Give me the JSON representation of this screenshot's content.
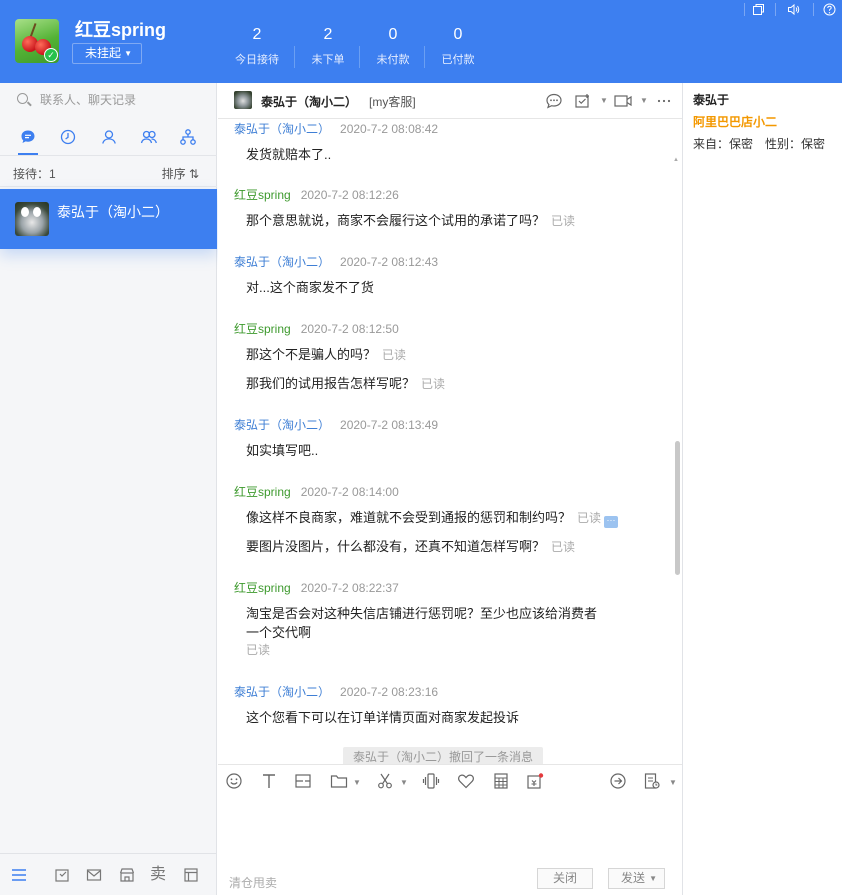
{
  "header": {
    "user_name": "红豆spring",
    "status": "未挂起",
    "stats": [
      {
        "value": "2",
        "label": "今日接待"
      },
      {
        "value": "2",
        "label": "未下单"
      },
      {
        "value": "0",
        "label": "未付款"
      },
      {
        "value": "0",
        "label": "已付款"
      }
    ],
    "colors": {
      "brand": "#3d7ff0",
      "online": "#27c24c"
    }
  },
  "left": {
    "search_placeholder": "联系人、聊天记录",
    "queue_label": "接待：1",
    "sort_label": "排序 ⇅",
    "conversation": {
      "name": "泰弘于（淘小二）"
    }
  },
  "chat": {
    "contact": "泰弘于（淘小二）",
    "service_tag": "[my客服]",
    "read_label": "已读",
    "messages": [
      {
        "who": "泰弘于（淘小二）",
        "time": "2020-7-2 08:08:42",
        "lines": [
          "发货就赔本了.."
        ],
        "read": false,
        "self": false
      },
      {
        "who": "红豆spring",
        "time": "2020-7-2 08:12:26",
        "lines": [
          "那个意思就说，商家不会履行这个试用的承诺了吗？"
        ],
        "read": true,
        "self": true
      },
      {
        "who": "泰弘于（淘小二）",
        "time": "2020-7-2 08:12:43",
        "lines": [
          "对...这个商家发不了货"
        ],
        "read": false,
        "self": false
      },
      {
        "who": "红豆spring",
        "time": "2020-7-2 08:12:50",
        "lines": [
          "那这个不是骗人的吗？",
          "那我们的试用报告怎样写呢？"
        ],
        "read": true,
        "self": true
      },
      {
        "who": "泰弘于（淘小二）",
        "time": "2020-7-2 08:13:49",
        "lines": [
          "如实填写吧.."
        ],
        "read": false,
        "self": false
      },
      {
        "who": "红豆spring",
        "time": "2020-7-2 08:14:00",
        "lines": [
          "像这样不良商家，难道就不会受到通报的惩罚和制约吗？",
          "要图片没图片，什么都没有，还真不知道怎样写啊？"
        ],
        "read": true,
        "self": true
      },
      {
        "who": "红豆spring",
        "time": "2020-7-2 08:22:37",
        "lines": [
          "淘宝是否会对这种失信店铺进行惩罚呢？至少也应该给消费者",
          "一个交代啊"
        ],
        "read": true,
        "self": true
      },
      {
        "who": "泰弘于（淘小二）",
        "time": "2020-7-2 08:23:16",
        "lines": [
          "这个您看下可以在订单详情页面对商家发起投诉"
        ],
        "read": false,
        "self": false
      }
    ],
    "recall_notice": "泰弘于（淘小二）撤回了一条消息",
    "footer_hint": "清仓甩卖",
    "close_label": "关闭",
    "send_label": "发送"
  },
  "right": {
    "name": "泰弘于",
    "org": "阿里巴巴店小二",
    "from_line": "来自：保密　性别：保密"
  }
}
